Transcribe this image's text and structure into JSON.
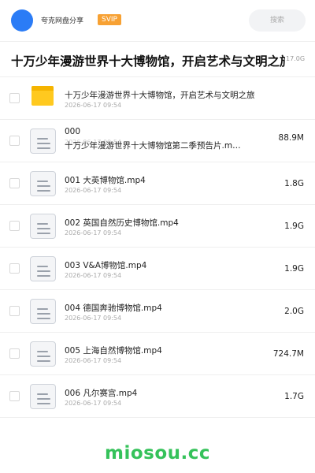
{
  "header": {
    "app_name": "夸克网盘分享",
    "badge": "SVIP",
    "search_placeholder": "搜索",
    "avatar_color": "#2b7cf6",
    "badge_color": "#f7a133"
  },
  "share": {
    "title": "十万少年漫游世界十大博物馆，开启艺术与文明之旅",
    "total_size": "17.0G"
  },
  "files": [
    {
      "icon": "folder-icon",
      "name": "十万少年漫游世界十大博物馆，开启艺术与文明之旅",
      "date": "2026-06-17 09:54",
      "size": ""
    },
    {
      "icon": "file-icon",
      "name": "000",
      "name2": "十万少年漫游世界十大博物馆第二季预告片.m…",
      "date": "2026-06-17 09:54",
      "size": "88.9M"
    },
    {
      "icon": "file-icon",
      "name": "001 大英博物馆.mp4",
      "date": "2026-06-17 09:54",
      "size": "1.8G"
    },
    {
      "icon": "file-icon",
      "name": "002 英国自然历史博物馆.mp4",
      "date": "2026-06-17 09:54",
      "size": "1.9G"
    },
    {
      "icon": "file-icon",
      "name": "003 V&A博物馆.mp4",
      "date": "2026-06-17 09:54",
      "size": "1.9G"
    },
    {
      "icon": "file-icon",
      "name": "004 德国奔驰博物馆.mp4",
      "date": "2026-06-17 09:54",
      "size": "2.0G"
    },
    {
      "icon": "file-icon",
      "name": "005 上海自然博物馆.mp4",
      "date": "2026-06-17 09:54",
      "size": "724.7M"
    },
    {
      "icon": "file-icon",
      "name": "006 凡尔赛宫.mp4",
      "date": "2026-06-17 09:54",
      "size": "1.7G"
    }
  ],
  "watermark": "miosou.cc",
  "watermark_color": "#35c25a"
}
